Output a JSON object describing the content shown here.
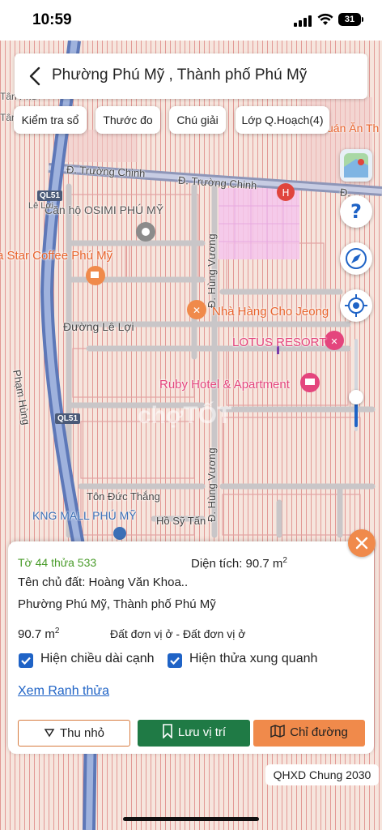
{
  "status": {
    "time": "10:59",
    "battery": "31"
  },
  "header": {
    "title": "Phường Phú Mỹ , Thành phố Phú Mỹ"
  },
  "toolbar": {
    "chips": [
      "Kiểm tra sổ",
      "Thước đo",
      "Chú giải",
      "Lớp Q.Hoạch(4)"
    ]
  },
  "map": {
    "labels": {
      "truong_chinh_1": "Đ. Trường Chinh",
      "truong_chinh_2": "Đ. Trường Chinh",
      "truong_chinh_3": "Đ.",
      "osimi": "Căn hộ OSIMI PHÚ MỸ",
      "le_loi_small": "Lê Lợi",
      "star_coffee": "a Star Coffee Phú Mỹ",
      "hung_vuong_1": "Đ. Hùng Vương",
      "hung_vuong_2": "Đ. Hùng Vương",
      "cho_jeong": "Nhà Hàng Cho Jeong",
      "duong_le_loi": "Đường Lê Lợi",
      "lotus": "LOTUS RESORT",
      "ruby": "Ruby Hotel & Apartment",
      "pham_hung": "Phạm Hùng",
      "tan_phuoc": "Tân Phư",
      "tan_thanh": "Tân Thành",
      "doan_an": "uán Ăn Th",
      "ton_duc_thang": "Tôn Đức Thắng",
      "ho_sy_tan": "Hồ Sỹ Tấn",
      "kng_mall": "KNG MALL PHÚ MỸ",
      "watermark": "chợTỐT"
    },
    "shields": [
      "QL51",
      "QL51"
    ],
    "icons": [
      "help-icon",
      "compass-icon",
      "my-location-icon",
      "map-layers-icon"
    ]
  },
  "panel": {
    "parcel": "Tờ 44 thửa 533",
    "area_label": "Diện tích: 90.7 m",
    "area_sup": "2",
    "owner": "Tên chủ đất: Hoàng Văn Khoa..",
    "address": "Phường Phú Mỹ, Thành phố Phú Mỹ",
    "area_small": "90.7 m",
    "area_small_sup": "2",
    "land_type": "Đất đơn vị ở - Đất đơn vị ở",
    "check_edges": "Hiện chiều dài cạnh",
    "check_neighbors": "Hiện thửa xung quanh",
    "boundary_link": "Xem Ranh thửa",
    "btn_collapse": "Thu nhỏ",
    "btn_save": "Lưu vị trí",
    "btn_route": "Chỉ đường",
    "colors": {
      "save": "#1f7a45",
      "route": "#f08a4b",
      "accent": "#1f63c6"
    }
  },
  "footer": {
    "plan_badge": "QHXD Chung 2030"
  }
}
